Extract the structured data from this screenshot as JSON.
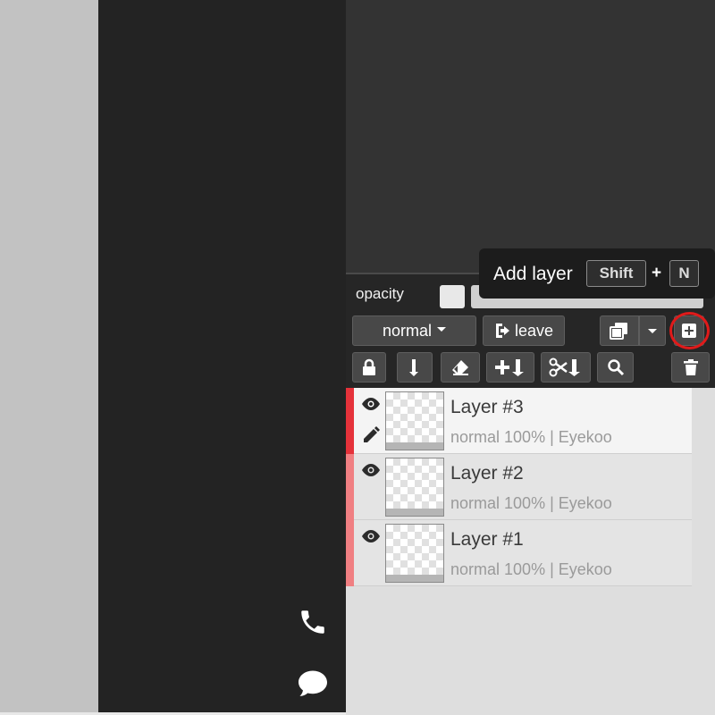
{
  "panel": {
    "opacity_label": "opacity",
    "blend_mode": "normal",
    "leave_label": "leave"
  },
  "tooltip": {
    "label": "Add layer",
    "shortcut_modifier": "Shift",
    "shortcut_plus": "+",
    "shortcut_key": "N"
  },
  "layers": [
    {
      "name": "Layer #3",
      "blend": "normal",
      "opacity": "100%",
      "separator": "|",
      "owner": "Eyekoo",
      "active": true
    },
    {
      "name": "Layer #2",
      "blend": "normal",
      "opacity": "100%",
      "separator": "|",
      "owner": "Eyekoo",
      "active": false
    },
    {
      "name": "Layer #1",
      "blend": "normal",
      "opacity": "100%",
      "separator": "|",
      "owner": "Eyekoo",
      "active": false
    }
  ],
  "icons": {
    "side": [
      "phone-icon",
      "chat-icon"
    ],
    "toolbar_top": [
      "sign-out-icon",
      "duplicate-icon",
      "chevron-down-icon",
      "add-layer-icon"
    ],
    "toolbar_bottom": [
      "lock-icon",
      "merge-down-icon",
      "eraser-icon",
      "add-merge-icon",
      "cut-merge-icon",
      "search-icon",
      "trash-icon"
    ],
    "layer_row": [
      "eye-icon",
      "pencil-icon"
    ]
  },
  "colors": {
    "active_accent": "#e5323a",
    "inactive_accent": "#f07f82",
    "highlight_ring": "#e01a1a",
    "panel_bg": "#262626"
  }
}
